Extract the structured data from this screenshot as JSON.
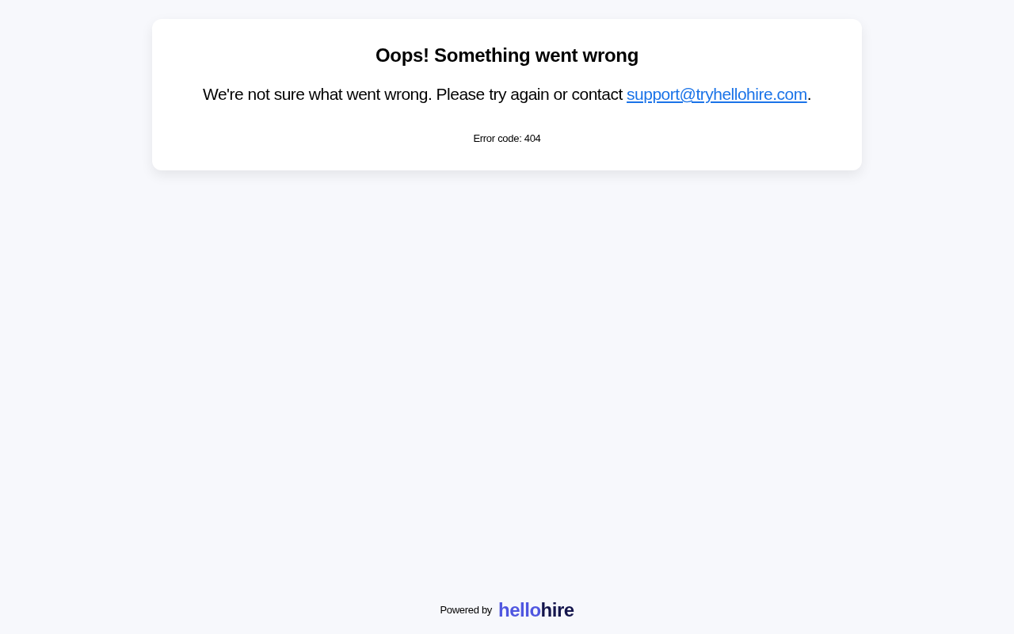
{
  "card": {
    "title": "Oops! Something went wrong",
    "message": {
      "before": "We're not sure what went wrong. Please try again or contact ",
      "link": "support@tryhellohire.com",
      "after": "."
    },
    "error_code": "Error code: 404"
  },
  "footer": {
    "powered_by": "Powered by",
    "logo": [
      {
        "text": "hello",
        "color": "#4f56e0"
      },
      {
        "text": "hire",
        "color": "#15164d"
      }
    ]
  }
}
